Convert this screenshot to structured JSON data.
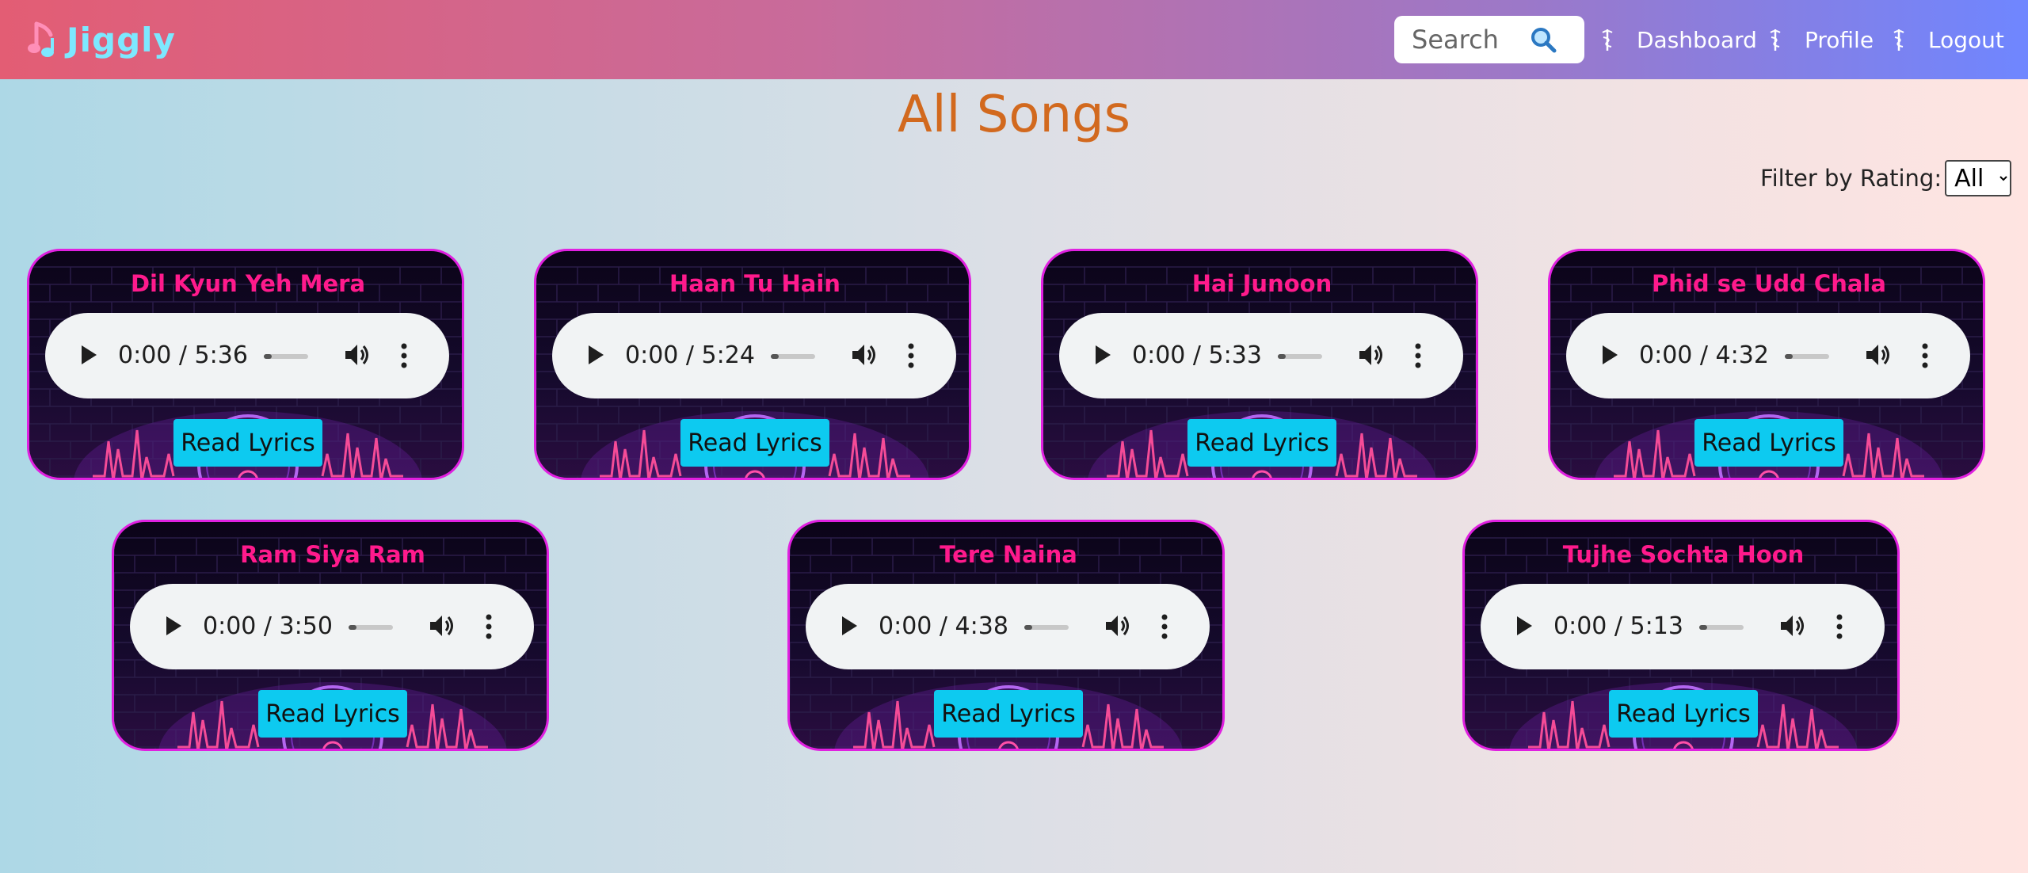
{
  "navbar": {
    "brand": "Jiggly",
    "search_placeholder": "Search",
    "links": [
      "Dashboard",
      "Profile",
      "Logout"
    ]
  },
  "page": {
    "title": "All Songs",
    "filter_label": "Filter by Rating:",
    "filter_selected": "All"
  },
  "player_button_label": "Read Lyrics",
  "songs": [
    {
      "title": "Dil Kyun Yeh Mera",
      "time": "0:00 / 5:36"
    },
    {
      "title": "Haan Tu Hain",
      "time": "0:00 / 5:24"
    },
    {
      "title": "Hai Junoon",
      "time": "0:00 / 5:33"
    },
    {
      "title": "Phid se Udd Chala",
      "time": "0:00 / 4:32"
    },
    {
      "title": "Ram Siya Ram",
      "time": "0:00 / 3:50"
    },
    {
      "title": "Tere Naina",
      "time": "0:00 / 4:38"
    },
    {
      "title": "Tujhe Sochta Hoon",
      "time": "0:00 / 5:13"
    }
  ],
  "icons": {
    "brand": "music-note-icon",
    "search": "magnifier-icon",
    "nav": "caduceus-icon",
    "play": "play-icon",
    "volume": "volume-icon",
    "more": "more-vertical-icon"
  },
  "colors": {
    "title": "#d2691e",
    "song_title": "#ff1a8c",
    "card_border": "#e020e0",
    "lyrics_button": "#0dcaf0",
    "brand_text": "#7de8ff"
  }
}
